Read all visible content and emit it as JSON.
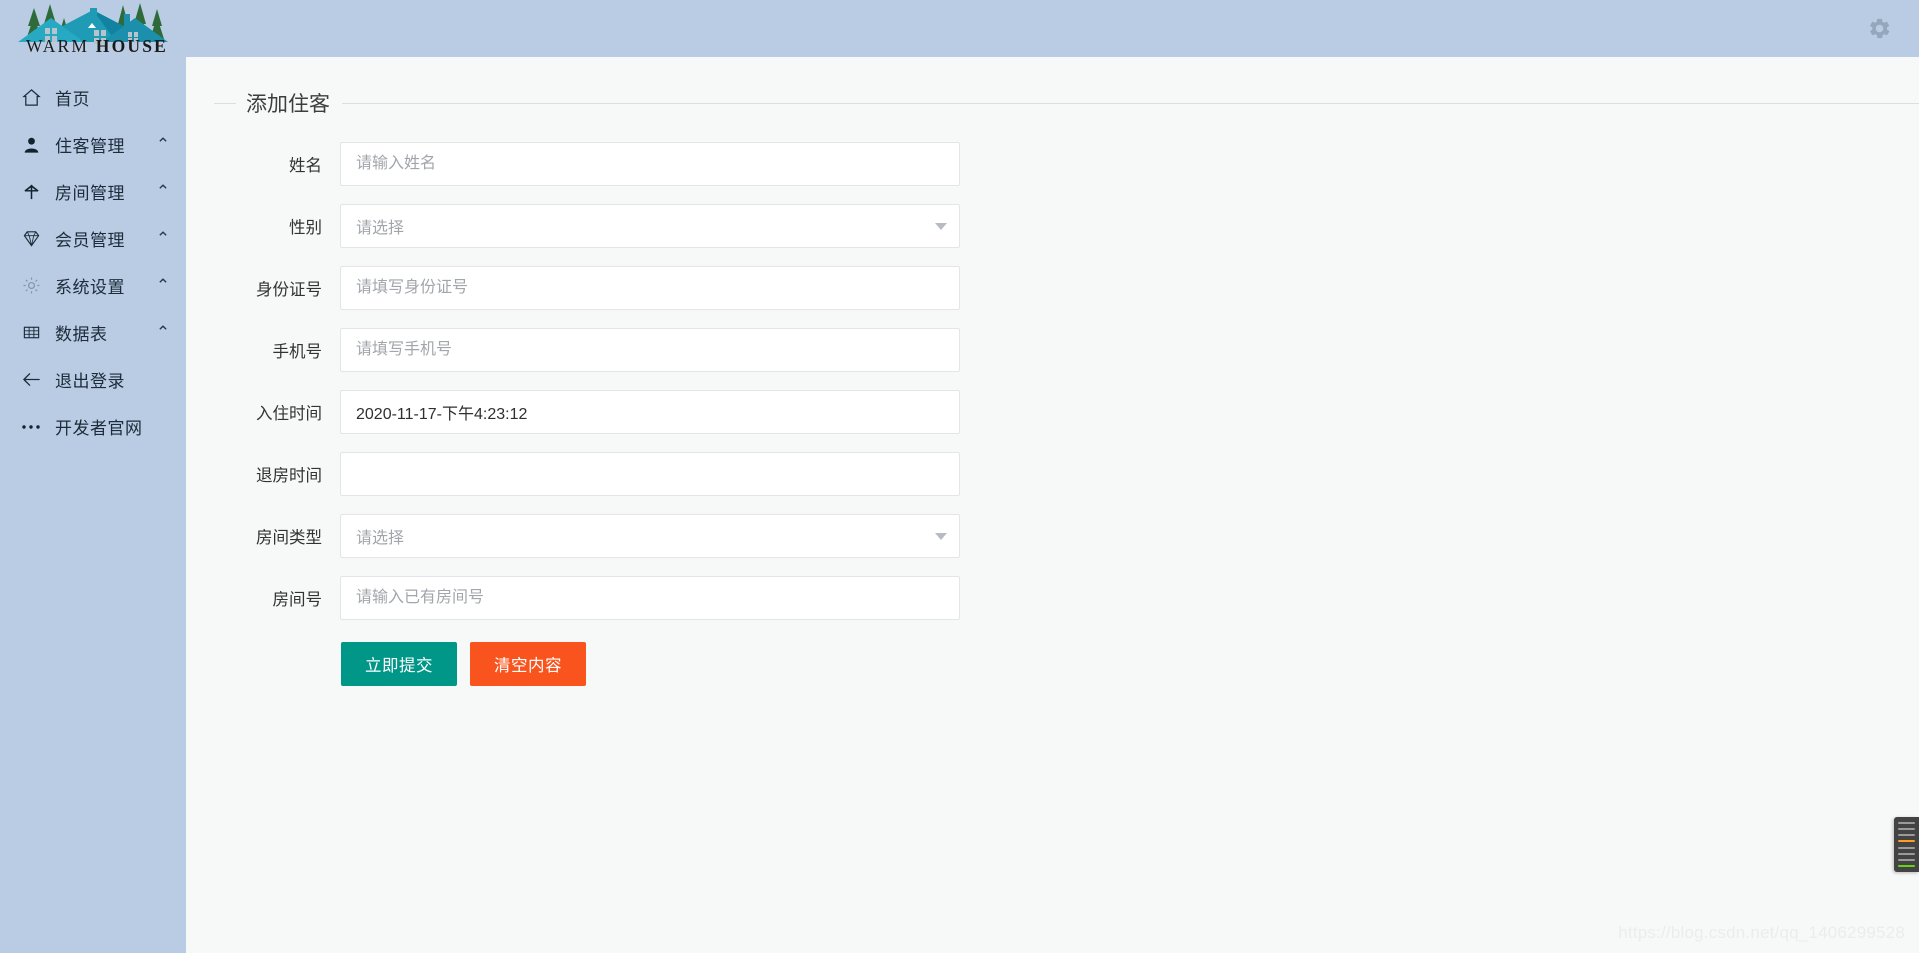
{
  "brand": {
    "name_part1": "WARM",
    "name_part2": "HOUSE",
    "logo_icon": "house-with-trees-logo"
  },
  "sidebar": {
    "items": [
      {
        "label": "首页",
        "icon": "home-icon",
        "chevron": ""
      },
      {
        "label": "住客管理",
        "icon": "user-icon",
        "chevron": "⌃"
      },
      {
        "label": "房间管理",
        "icon": "bed-icon",
        "chevron": "⌃"
      },
      {
        "label": "会员管理",
        "icon": "diamond-icon",
        "chevron": "⌃"
      },
      {
        "label": "系统设置",
        "icon": "gear-icon",
        "chevron": "⌃"
      },
      {
        "label": "数据表",
        "icon": "table-icon",
        "chevron": "⌃"
      },
      {
        "label": "退出登录",
        "icon": "arrow-left-icon",
        "chevron": ""
      },
      {
        "label": "开发者官网",
        "icon": "ellipsis-icon",
        "chevron": ""
      }
    ]
  },
  "topbar": {
    "settings_icon": "gear-icon"
  },
  "panel": {
    "title": "添加住客"
  },
  "form": {
    "fields": [
      {
        "label": "姓名",
        "type": "text",
        "value": "",
        "placeholder": "请输入姓名"
      },
      {
        "label": "性别",
        "type": "select",
        "value": "请选择",
        "placeholder": "请选择"
      },
      {
        "label": "身份证号",
        "type": "text",
        "value": "",
        "placeholder": "请填写身份证号"
      },
      {
        "label": "手机号",
        "type": "text",
        "value": "",
        "placeholder": "请填写手机号"
      },
      {
        "label": "入住时间",
        "type": "text",
        "value": "2020-11-17-下午4:23:12",
        "placeholder": ""
      },
      {
        "label": "退房时间",
        "type": "text",
        "value": "",
        "placeholder": ""
      },
      {
        "label": "房间类型",
        "type": "select",
        "value": "请选择",
        "placeholder": "请选择"
      },
      {
        "label": "房间号",
        "type": "text",
        "value": "",
        "placeholder": "请输入已有房间号"
      }
    ],
    "submit_label": "立即提交",
    "reset_label": "清空内容"
  },
  "watermark": "https://blog.csdn.net/qq_1406299528",
  "colors": {
    "sidebar_bg": "#b9cce3",
    "topbar_bg": "#b9cce3",
    "content_bg": "#f7f8f8",
    "submit_green": "#009688",
    "reset_orange": "#f9541e",
    "field_border": "#e3e5e8",
    "placeholder": "#a2a6ab"
  }
}
